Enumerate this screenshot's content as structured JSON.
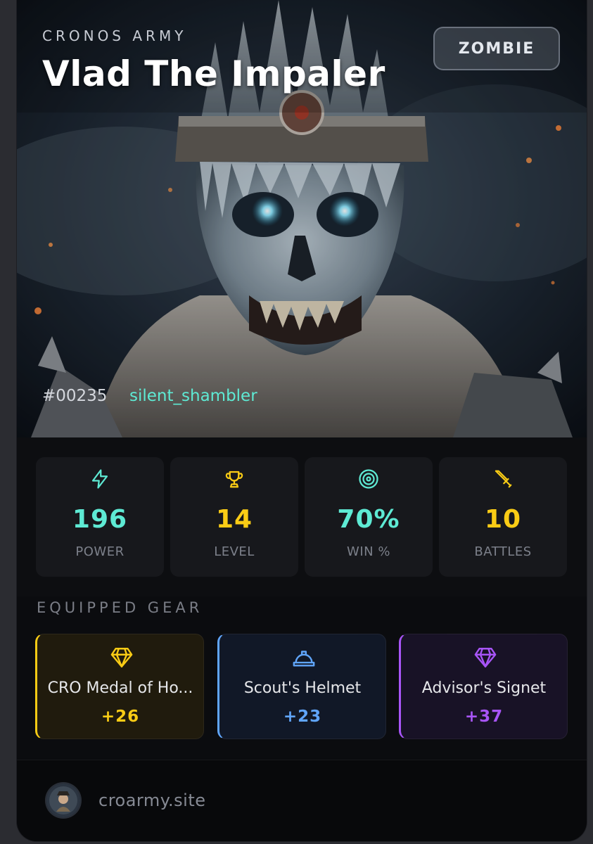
{
  "card": {
    "collection": "CRONOS ARMY",
    "name": "Vlad The Impaler",
    "type_badge": "ZOMBIE",
    "token_id": "#00235",
    "owner": "silent_shambler"
  },
  "stats": [
    {
      "icon": "lightning-icon",
      "value": "196",
      "label": "POWER",
      "color": "#5eead4"
    },
    {
      "icon": "trophy-icon",
      "value": "14",
      "label": "LEVEL",
      "color": "#facc15"
    },
    {
      "icon": "target-icon",
      "value": "70%",
      "label": "WIN %",
      "color": "#5eead4"
    },
    {
      "icon": "sword-icon",
      "value": "10",
      "label": "BATTLES",
      "color": "#facc15"
    }
  ],
  "gear": {
    "heading": "EQUIPPED GEAR",
    "items": [
      {
        "icon": "diamond-icon",
        "name": "CRO Medal of Ho...",
        "bonus": "+26",
        "accent": "#facc15",
        "bg": "#201b0d"
      },
      {
        "icon": "helmet-icon",
        "name": "Scout's Helmet",
        "bonus": "+23",
        "accent": "#60a5fa",
        "bg": "#111827"
      },
      {
        "icon": "diamond-icon",
        "name": "Advisor's Signet",
        "bonus": "+37",
        "accent": "#a855f7",
        "bg": "#181226"
      }
    ]
  },
  "footer": {
    "site": "croarmy.site"
  }
}
